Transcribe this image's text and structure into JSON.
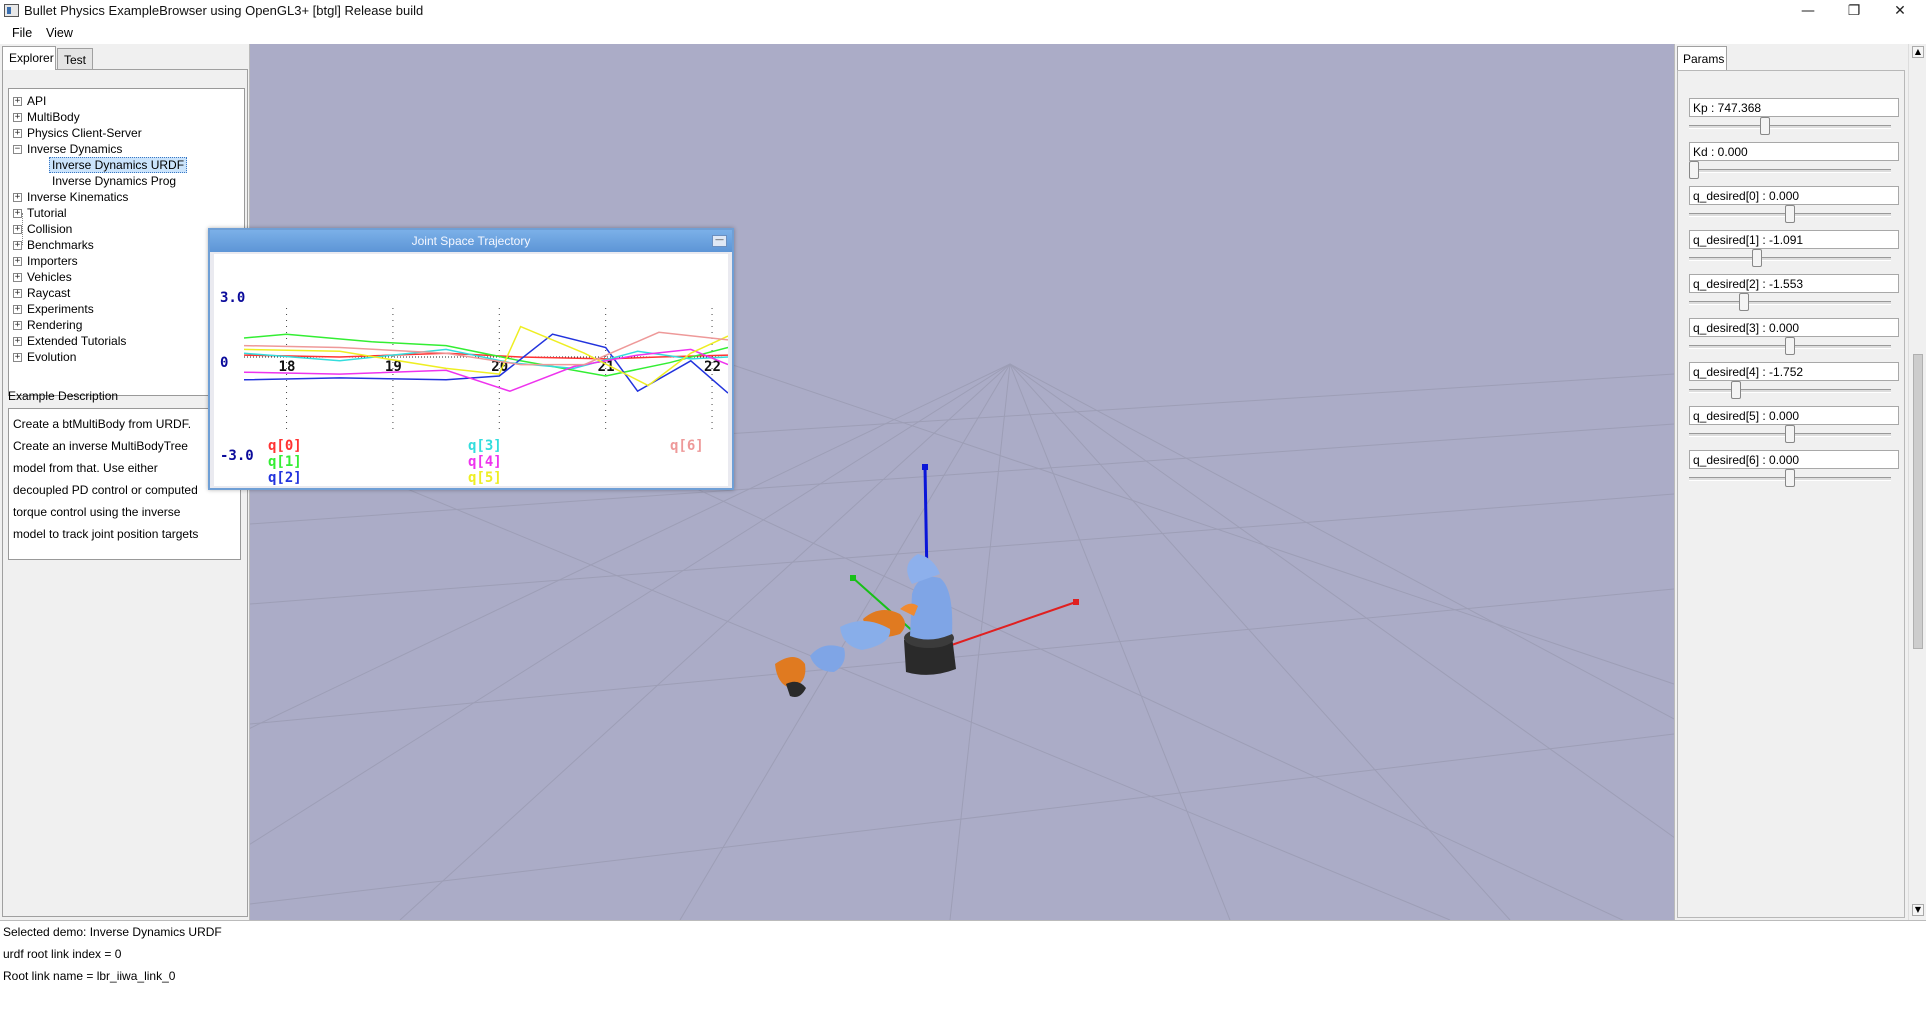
{
  "window": {
    "title": "Bullet Physics ExampleBrowser using OpenGL3+ [btgl] Release build",
    "minimize_icon": "minimize-icon",
    "restore_icon": "restore-icon",
    "close_icon": "close-icon"
  },
  "menu": {
    "items": [
      "File",
      "View"
    ]
  },
  "left_panel": {
    "tabs": [
      "Explorer",
      "Test"
    ],
    "tree": [
      {
        "label": "API",
        "expanded": false
      },
      {
        "label": "MultiBody",
        "expanded": false
      },
      {
        "label": "Physics Client-Server",
        "expanded": false
      },
      {
        "label": "Inverse Dynamics",
        "expanded": true
      },
      {
        "label": "Inverse Dynamics URDF",
        "child": true,
        "selected": true
      },
      {
        "label": "Inverse Dynamics Prog",
        "child": true
      },
      {
        "label": "Inverse Kinematics",
        "expanded": false
      },
      {
        "label": "Tutorial",
        "expanded": false
      },
      {
        "label": "Collision",
        "expanded": false
      },
      {
        "label": "Benchmarks",
        "expanded": false
      },
      {
        "label": "Importers",
        "expanded": false
      },
      {
        "label": "Vehicles",
        "expanded": false
      },
      {
        "label": "Raycast",
        "expanded": false
      },
      {
        "label": "Experiments",
        "expanded": false
      },
      {
        "label": "Rendering",
        "expanded": false
      },
      {
        "label": "Extended Tutorials",
        "expanded": false
      },
      {
        "label": "Evolution",
        "expanded": false
      }
    ],
    "description_header": "Example Description",
    "description_lines": [
      "Create a btMultiBody from URDF.",
      "Create an inverse MultiBodyTree",
      "model from that. Use either",
      "decoupled PD control or computed",
      "torque control using the inverse",
      "model to track joint position targets"
    ]
  },
  "params_panel": {
    "tab": "Params",
    "params": [
      {
        "label": "Kp : 747.368",
        "slider_fraction": 0.37
      },
      {
        "label": "Kd : 0.000",
        "slider_fraction": 0.0
      },
      {
        "label": "q_desired[0] : 0.000",
        "slider_fraction": 0.5
      },
      {
        "label": "q_desired[1] : -1.091",
        "slider_fraction": 0.33
      },
      {
        "label": "q_desired[2] : -1.553",
        "slider_fraction": 0.26
      },
      {
        "label": "q_desired[3] : 0.000",
        "slider_fraction": 0.5
      },
      {
        "label": "q_desired[4] : -1.752",
        "slider_fraction": 0.22
      },
      {
        "label": "q_desired[5] : 0.000",
        "slider_fraction": 0.5
      },
      {
        "label": "q_desired[6] : 0.000",
        "slider_fraction": 0.5
      }
    ]
  },
  "trajectory_window": {
    "title": "Joint Space Trajectory",
    "chart_data": {
      "type": "line",
      "title": "",
      "ylim": [
        -3.0,
        3.0
      ],
      "y_tick_labels": [
        "3.0",
        "0",
        "-3.0"
      ],
      "x_tick_labels": [
        "18",
        "19",
        "20",
        "21",
        "22"
      ],
      "xlim": [
        17.6,
        22.15
      ],
      "series": [
        {
          "name": "q[0]",
          "color": "#ff3333",
          "x": [
            17.6,
            18.5,
            19.5,
            20.2,
            21.0,
            21.5,
            22.15
          ],
          "y": [
            0.1,
            0.0,
            0.2,
            0.0,
            -0.1,
            0.0,
            0.1
          ]
        },
        {
          "name": "q[1]",
          "color": "#33ee33",
          "x": [
            17.6,
            18.0,
            18.8,
            19.5,
            20.2,
            21.0,
            21.6,
            22.15
          ],
          "y": [
            1.0,
            1.2,
            0.8,
            0.6,
            -0.2,
            -1.0,
            -0.3,
            0.5
          ]
        },
        {
          "name": "q[2]",
          "color": "#2233dd",
          "x": [
            17.6,
            18.5,
            19.5,
            20.0,
            20.5,
            21.0,
            21.3,
            21.8,
            22.15
          ],
          "y": [
            -1.2,
            -1.1,
            -1.2,
            -1.0,
            1.2,
            0.5,
            -1.8,
            -0.2,
            -1.9
          ]
        },
        {
          "name": "q[3]",
          "color": "#33dddd",
          "x": [
            17.6,
            18.5,
            19.5,
            20.1,
            20.7,
            21.3,
            21.8,
            22.15
          ],
          "y": [
            0.2,
            -0.2,
            0.4,
            -0.3,
            -0.6,
            0.3,
            -0.1,
            0.0
          ]
        },
        {
          "name": "q[4]",
          "color": "#ee33ee",
          "x": [
            17.6,
            18.5,
            19.5,
            20.1,
            20.7,
            21.3,
            21.8,
            22.15
          ],
          "y": [
            -0.8,
            -0.9,
            -0.7,
            -1.8,
            -0.5,
            0.1,
            0.4,
            -0.4
          ]
        },
        {
          "name": "q[5]",
          "color": "#eeee22",
          "x": [
            17.6,
            18.5,
            19.5,
            20.0,
            20.2,
            20.8,
            21.4,
            21.8,
            22.15
          ],
          "y": [
            0.4,
            0.3,
            -0.6,
            -0.9,
            1.6,
            0.2,
            -1.5,
            0.2,
            1.1
          ]
        },
        {
          "name": "q[6]",
          "color": "#ee9999",
          "x": [
            17.6,
            18.5,
            19.5,
            20.2,
            20.8,
            21.5,
            22.15
          ],
          "y": [
            0.6,
            0.5,
            0.2,
            -0.4,
            -0.4,
            1.3,
            0.9
          ]
        }
      ]
    }
  },
  "console": {
    "lines": [
      "Selected demo: Inverse Dynamics URDF",
      "urdf root link index = 0",
      "Root link name = lbr_iiwa_link_0"
    ]
  }
}
